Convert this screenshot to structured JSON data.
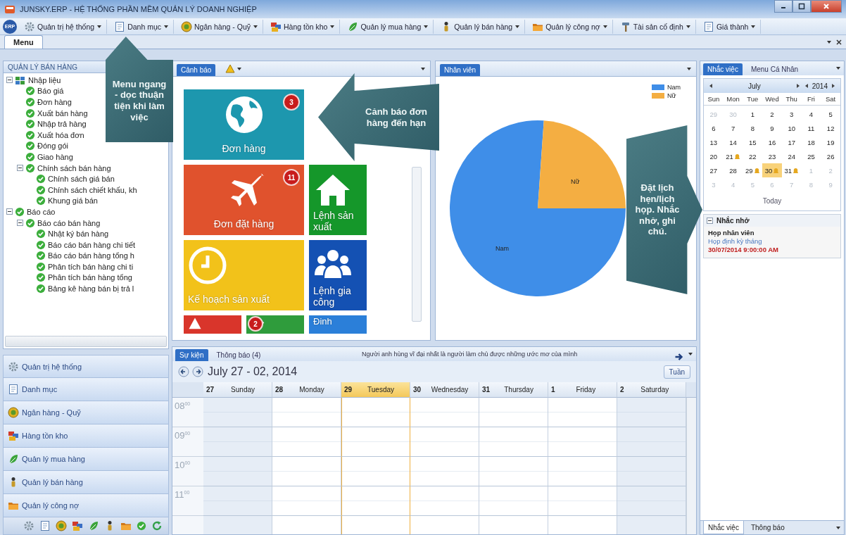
{
  "window": {
    "title": "JUNSKY.ERP - HỆ THỐNG PHẦN MỀM QUẢN LÝ DOANH NGHIỆP"
  },
  "menubar": {
    "logo_text": "ERP",
    "items": [
      {
        "label": "Quản trị hệ thống",
        "kind": "gear"
      },
      {
        "label": "Danh mục",
        "kind": "document"
      },
      {
        "label": "Ngân hàng - Quỹ",
        "kind": "coin"
      },
      {
        "label": "Hàng tồn kho",
        "kind": "boxes"
      },
      {
        "label": "Quản lý mua hàng",
        "kind": "leaf"
      },
      {
        "label": "Quản lý bán hàng",
        "kind": "person"
      },
      {
        "label": "Quản lý công nợ",
        "kind": "folder"
      },
      {
        "label": "Tài sản cố định",
        "kind": "hammer"
      },
      {
        "label": "Giá thành",
        "kind": "document"
      }
    ]
  },
  "document_tabs": [
    {
      "label": "Menu",
      "selected": true
    }
  ],
  "sidebar": {
    "title": "QUẢN LÝ BÁN HÀNG",
    "tree": [
      {
        "label": "Nhập liệu",
        "kind": "grid",
        "expanded": true,
        "children": [
          {
            "label": "Báo giá",
            "kind": "check"
          },
          {
            "label": "Đơn hàng",
            "kind": "check"
          },
          {
            "label": "Xuất bán hàng",
            "kind": "check"
          },
          {
            "label": "Nhập trả hàng",
            "kind": "check"
          },
          {
            "label": "Xuất hóa đơn",
            "kind": "check"
          },
          {
            "label": "Đóng gói",
            "kind": "check"
          },
          {
            "label": "Giao hàng",
            "kind": "check"
          },
          {
            "label": "Chính sách bán hàng",
            "kind": "check",
            "expanded": true,
            "children": [
              {
                "label": "Chính sách giá bán",
                "kind": "check"
              },
              {
                "label": "Chính sách chiết khấu, kh",
                "kind": "check"
              },
              {
                "label": "Khung giá bán",
                "kind": "check"
              }
            ]
          }
        ]
      },
      {
        "label": "Báo cáo",
        "kind": "check",
        "expanded": true,
        "children": [
          {
            "label": "Báo cáo bán hàng",
            "kind": "check",
            "expanded": true,
            "children": [
              {
                "label": "Nhật ký bán hàng",
                "kind": "check"
              },
              {
                "label": "Báo cáo bán hàng chi tiết",
                "kind": "check"
              },
              {
                "label": "Báo cáo bán hàng tổng h",
                "kind": "check"
              },
              {
                "label": "Phân tích bán hàng chi ti",
                "kind": "check"
              },
              {
                "label": "Phân tích bán hàng tổng",
                "kind": "check"
              },
              {
                "label": "Bảng kê hàng bán bị trả l",
                "kind": "check"
              }
            ]
          }
        ]
      }
    ],
    "modules": [
      {
        "label": "Quản trị hệ thống",
        "kind": "gear"
      },
      {
        "label": "Danh mục",
        "kind": "document"
      },
      {
        "label": "Ngân hàng - Quỹ",
        "kind": "coin"
      },
      {
        "label": "Hàng tồn kho",
        "kind": "boxes"
      },
      {
        "label": "Quản lý mua hàng",
        "kind": "leaf"
      },
      {
        "label": "Quản lý bán hàng",
        "kind": "person"
      },
      {
        "label": "Quản lý công nợ",
        "kind": "folder"
      }
    ],
    "shortcuts": [
      {
        "kind": "gear"
      },
      {
        "kind": "document"
      },
      {
        "kind": "coin"
      },
      {
        "kind": "boxes"
      },
      {
        "kind": "leaf"
      },
      {
        "kind": "person"
      },
      {
        "kind": "folder"
      },
      {
        "kind": "check"
      },
      {
        "kind": "refresh"
      }
    ]
  },
  "alerts_panel": {
    "tabs": [
      {
        "label": "Cảnh báo",
        "selected": true
      }
    ],
    "tile_rows": [
      {
        "partial": false,
        "tiles": [
          {
            "label": "Đơn hàng",
            "color": "#1d97ae",
            "kind": "globe",
            "wide": true,
            "badge": "3",
            "centered": true
          }
        ]
      },
      {
        "partial": false,
        "tiles": [
          {
            "label": "Đơn đặt hàng",
            "color": "#e0522d",
            "kind": "plane",
            "wide": true,
            "badge": "11",
            "centered": true
          },
          {
            "label": "Lệnh sản xuất",
            "color": "#15972a",
            "kind": "house",
            "wide": false,
            "centered": false
          }
        ]
      },
      {
        "partial": false,
        "tiles": [
          {
            "label": "Kế hoạch sản xuất",
            "color": "#f2c21a",
            "kind": "clock",
            "wide": true,
            "centered": false
          },
          {
            "label": "Lệnh gia công",
            "color": "#1451b3",
            "kind": "people",
            "wide": false,
            "centered": false
          }
        ]
      },
      {
        "partial": true,
        "tiles": [
          {
            "color": "#d9352b",
            "kind": "warning",
            "wide": false
          },
          {
            "color": "#2f9c3c",
            "kind": "share",
            "wide": false,
            "badge": "2"
          },
          {
            "label": "Đinh",
            "color": "#2b7fd9",
            "wide": false,
            "centered": false
          }
        ]
      }
    ]
  },
  "staff_panel": {
    "tabs": [
      {
        "label": "Nhân viên",
        "selected": true
      }
    ],
    "legend": [
      {
        "label": "Nam",
        "color": "#3f8ee8"
      },
      {
        "label": "Nữ",
        "color": "#f4ae42"
      }
    ],
    "slice_labels": [
      "Nam",
      "Nữ"
    ]
  },
  "events": {
    "tabs": [
      {
        "label": "Sự kiện",
        "selected": true
      },
      {
        "label": "Thông báo (4)",
        "selected": false
      }
    ],
    "quote": "Người anh hùng vĩ đại nhất là người làm chủ được những ước mơ của mình",
    "range": "July 27 - 02, 2014",
    "view_button": "Tuần",
    "days": [
      {
        "number": "27",
        "name": "Sunday",
        "weekend": true,
        "selected": false
      },
      {
        "number": "28",
        "name": "Monday",
        "weekend": false,
        "selected": false
      },
      {
        "number": "29",
        "name": "Tuesday",
        "weekend": false,
        "selected": true
      },
      {
        "number": "30",
        "name": "Wednesday",
        "weekend": false,
        "selected": false
      },
      {
        "number": "31",
        "name": "Thursday",
        "weekend": false,
        "selected": false
      },
      {
        "number": "1",
        "name": "Friday",
        "weekend": false,
        "selected": false
      },
      {
        "number": "2",
        "name": "Saturday",
        "weekend": true,
        "selected": false
      }
    ],
    "time_slots": [
      "08$^{00}$",
      "09$^{00}$",
      "10$^{00}$",
      "11$^{00}$"
    ]
  },
  "reminders": {
    "tabs": [
      {
        "label": "Nhắc việc",
        "selected": true
      },
      {
        "label": "Menu Cá Nhân",
        "selected": false
      }
    ],
    "calendar": {
      "month": "July",
      "year": "2014",
      "weekdays": [
        "Sun",
        "Mon",
        "Tue",
        "Wed",
        "Thu",
        "Fri",
        "Sat"
      ],
      "weeks": [
        [
          {
            "day": "29",
            "other_month": true,
            "alert": false,
            "selected": false
          },
          {
            "day": "30",
            "other_month": true,
            "alert": false,
            "selected": false
          },
          {
            "day": "1",
            "other_month": false,
            "alert": false,
            "selected": false
          },
          {
            "day": "2",
            "other_month": false,
            "alert": false,
            "selected": false
          },
          {
            "day": "3",
            "other_month": false,
            "alert": false,
            "selected": false
          },
          {
            "day": "4",
            "other_month": false,
            "alert": false,
            "selected": false
          },
          {
            "day": "5",
            "other_month": false,
            "alert": false,
            "selected": false
          }
        ],
        [
          {
            "day": "6",
            "other_month": false,
            "alert": false,
            "selected": false
          },
          {
            "day": "7",
            "other_month": false,
            "alert": false,
            "selected": false
          },
          {
            "day": "8",
            "other_month": false,
            "alert": false,
            "selected": false
          },
          {
            "day": "9",
            "other_month": false,
            "alert": false,
            "selected": false
          },
          {
            "day": "10",
            "other_month": false,
            "alert": false,
            "selected": false
          },
          {
            "day": "11",
            "other_month": false,
            "alert": false,
            "selected": false
          },
          {
            "day": "12",
            "other_month": false,
            "alert": false,
            "selected": false
          }
        ],
        [
          {
            "day": "13",
            "other_month": false,
            "alert": false,
            "selected": false
          },
          {
            "day": "14",
            "other_month": false,
            "alert": false,
            "selected": false
          },
          {
            "day": "15",
            "other_month": false,
            "alert": false,
            "selected": false
          },
          {
            "day": "16",
            "other_month": false,
            "alert": false,
            "selected": false
          },
          {
            "day": "17",
            "other_month": false,
            "alert": false,
            "selected": false
          },
          {
            "day": "18",
            "other_month": false,
            "alert": false,
            "selected": false
          },
          {
            "day": "19",
            "other_month": false,
            "alert": false,
            "selected": false
          }
        ],
        [
          {
            "day": "20",
            "other_month": false,
            "alert": false,
            "selected": false
          },
          {
            "day": "21",
            "other_month": false,
            "alert": true,
            "selected": false
          },
          {
            "day": "22",
            "other_month": false,
            "alert": false,
            "selected": false
          },
          {
            "day": "23",
            "other_month": false,
            "alert": false,
            "selected": false
          },
          {
            "day": "24",
            "other_month": false,
            "alert": false,
            "selected": false
          },
          {
            "day": "25",
            "other_month": false,
            "alert": false,
            "selected": false
          },
          {
            "day": "26",
            "other_month": false,
            "alert": false,
            "selected": false
          }
        ],
        [
          {
            "day": "27",
            "other_month": false,
            "alert": false,
            "selected": false
          },
          {
            "day": "28",
            "other_month": false,
            "alert": false,
            "selected": false
          },
          {
            "day": "29",
            "other_month": false,
            "alert": true,
            "selected": false
          },
          {
            "day": "30",
            "other_month": false,
            "alert": true,
            "selected": true
          },
          {
            "day": "31",
            "other_month": false,
            "alert": true,
            "selected": false
          },
          {
            "day": "1",
            "other_month": true,
            "alert": false,
            "selected": false
          },
          {
            "day": "2",
            "other_month": true,
            "alert": false,
            "selected": false
          }
        ],
        [
          {
            "day": "3",
            "other_month": true,
            "alert": false,
            "selected": false
          },
          {
            "day": "4",
            "other_month": true,
            "alert": false,
            "selected": false
          },
          {
            "day": "5",
            "other_month": true,
            "alert": false,
            "selected": false
          },
          {
            "day": "6",
            "other_month": true,
            "alert": false,
            "selected": false
          },
          {
            "day": "7",
            "other_month": true,
            "alert": false,
            "selected": false
          },
          {
            "day": "8",
            "other_month": true,
            "alert": false,
            "selected": false
          },
          {
            "day": "9",
            "other_month": true,
            "alert": false,
            "selected": false
          }
        ]
      ],
      "today_button": "Today"
    },
    "section": {
      "title": "Nhắc nhở",
      "expanded": true,
      "items": [
        {
          "title": "Họp nhân viên",
          "subtitle": "Họp định kỳ tháng",
          "time": "30/07/2014 9:00:00 AM"
        }
      ]
    },
    "bottom_tabs": [
      {
        "label": "Nhắc việc",
        "selected": true
      },
      {
        "label": "Thông báo",
        "selected": false
      }
    ]
  },
  "callouts": [
    {
      "text": "Menu ngang - dọc thuận tiện khi làm việc",
      "kind": "up"
    },
    {
      "text": "Cảnh báo đơn hàng đến hạn",
      "kind": "left"
    },
    {
      "text": "Đặt lịch hẹn/lịch họp. Nhắc nhở, ghi chú.",
      "kind": "right"
    }
  ]
}
